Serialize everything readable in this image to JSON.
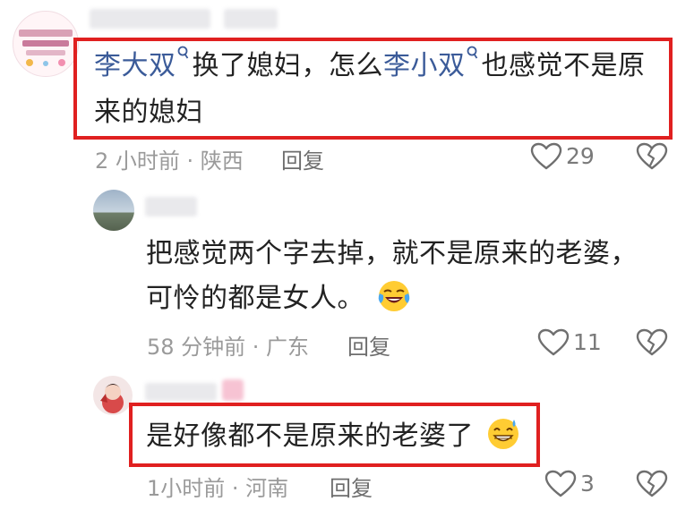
{
  "comments": [
    {
      "mention_1": "李大双",
      "text_1": "换了媳妇，怎么",
      "mention_2": "李小双",
      "text_2": "也感觉不是原",
      "line_2": "来的媳妇",
      "meta": "2 小时前 · 陕西",
      "reply_label": "回复",
      "likes": "29"
    },
    {
      "line_1": "把感觉两个字去掉，就不是原来的老婆，",
      "line_2": "可怜的都是女人。",
      "meta": "58 分钟前 · 广东",
      "reply_label": "回复",
      "likes": "11"
    },
    {
      "line_1": "是好像都不是原来的老婆了",
      "meta": "1小时前 · 河南",
      "reply_label": "回复",
      "likes": "3"
    }
  ],
  "colors": {
    "highlight_border": "#e02020",
    "mention": "#3b5b99",
    "meta": "#9a9a9a"
  },
  "icons": [
    "heart-icon",
    "broken-heart-icon",
    "crying-laugh-emoji",
    "sweat-smile-emoji",
    "search-mention-icon"
  ]
}
